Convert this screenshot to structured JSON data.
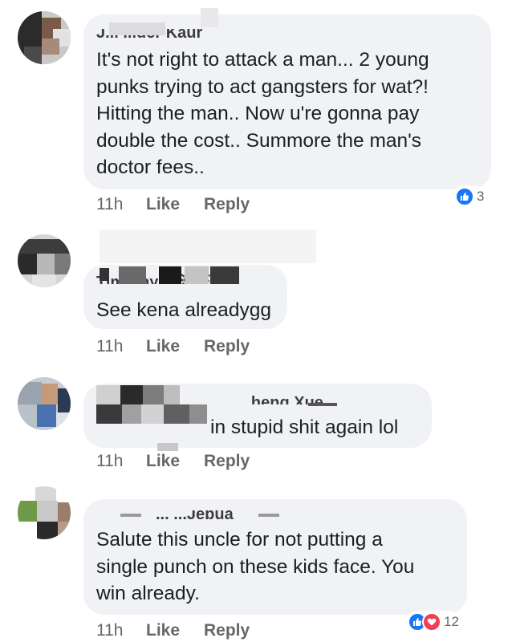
{
  "comments": [
    {
      "author": "J... ...der Kaur",
      "text": "It's not right to attack a man... 2 young\npunks trying to act gangsters for wat?!\nHitting the man.. Now u're gonna pay\ndouble the cost.. Summore the man's\ndoctor fees..",
      "time": "11h",
      "like_label": "Like",
      "reply_label": "Reply",
      "reactions": {
        "count": "3",
        "types": [
          "like-icon"
        ]
      }
    },
    {
      "author": "Timothy 江浩正",
      "text": "See kena alreadygg",
      "time": "11h",
      "like_label": "Like",
      "reply_label": "Reply"
    },
    {
      "author": "... ...heng Xue",
      "text": "in stupid shit again lol",
      "time": "11h",
      "like_label": "Like",
      "reply_label": "Reply"
    },
    {
      "author": "... ...Jebua",
      "text": "Salute this uncle for not putting a\nsingle punch on these kids face. You\nwin already.",
      "time": "11h",
      "like_label": "Like",
      "reply_label": "Reply",
      "reactions": {
        "count": "12",
        "types": [
          "like-icon",
          "heart-icon"
        ]
      }
    }
  ],
  "colors": {
    "bubble": "#f0f2f5",
    "text": "#1c1e21",
    "muted": "#65676b",
    "like_blue": "#1877f2",
    "love_red": "#f33e58"
  }
}
